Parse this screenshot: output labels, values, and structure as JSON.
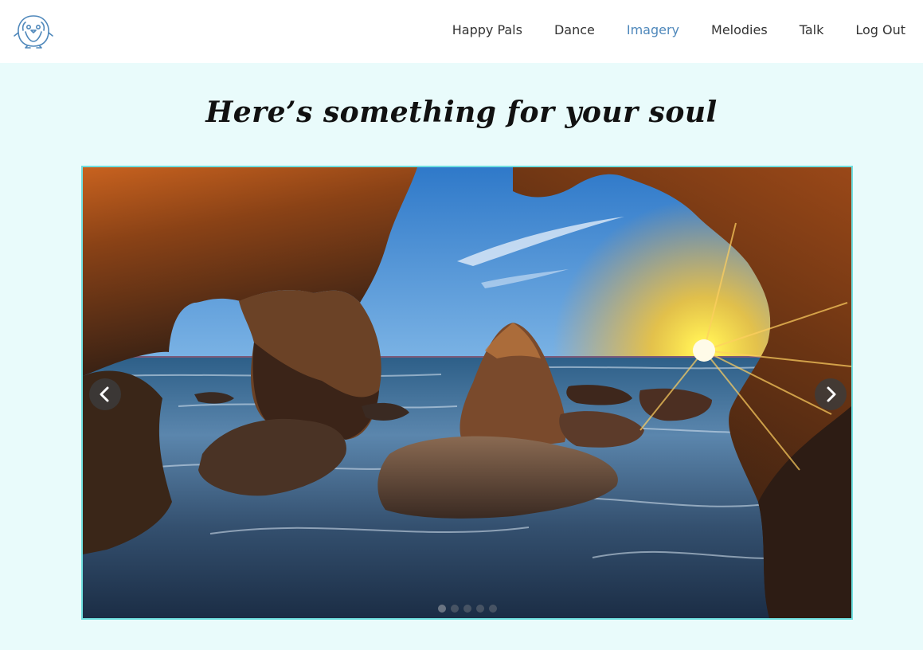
{
  "header": {
    "logo_icon": "penguin-icon",
    "nav": [
      {
        "label": "Happy Pals",
        "active": false
      },
      {
        "label": "Dance",
        "active": false
      },
      {
        "label": "Imagery",
        "active": true
      },
      {
        "label": "Melodies",
        "active": false
      },
      {
        "label": "Talk",
        "active": false
      },
      {
        "label": "Log Out",
        "active": false
      }
    ]
  },
  "main": {
    "heading": "Here’s something for your soul"
  },
  "carousel": {
    "prev_icon": "chevron-left-icon",
    "next_icon": "chevron-right-icon",
    "slide_count": 5,
    "active_index": 0
  },
  "colors": {
    "page_background": "#e9fbfb",
    "nav_active": "#4f88bb",
    "carousel_border": "#6fdfdf"
  }
}
